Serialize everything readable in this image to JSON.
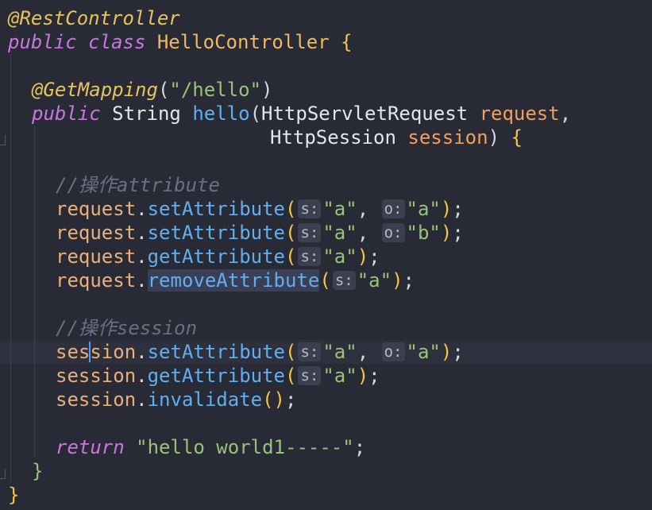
{
  "code": {
    "annotation_rest": "@RestController",
    "kw_public": "public",
    "kw_class": "class",
    "class_name": "HelloController",
    "brace_open": "{",
    "brace_close": "}",
    "annotation_get": "@GetMapping",
    "mapping_path": "\"/hello\"",
    "type_string": "String",
    "method_name": "hello",
    "type_request": "HttpServletRequest",
    "param_request": "request",
    "type_session": "HttpSession",
    "param_session": "session",
    "comment_attribute": "//操作attribute",
    "comment_session": "//操作session",
    "var_request": "request",
    "var_session": "session",
    "m_set": "setAttribute",
    "m_get": "getAttribute",
    "m_remove": "removeAttribute",
    "m_invalidate": "invalidate",
    "hint_s": "s:",
    "hint_o": "o:",
    "str_a": "\"a\"",
    "str_b": "\"b\"",
    "kw_return": "return",
    "return_value": "\"hello world1-----\""
  }
}
